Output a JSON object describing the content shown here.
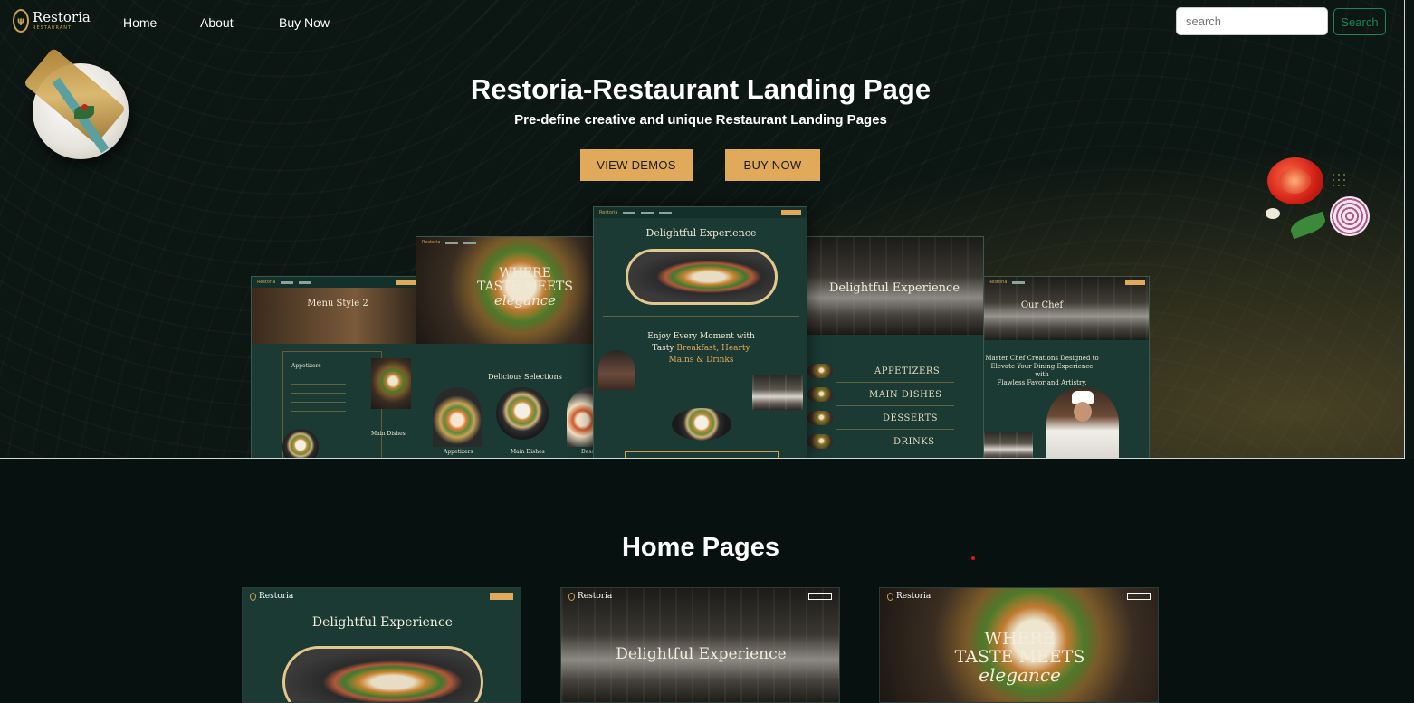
{
  "brand": {
    "name": "Restoria",
    "sub": "RESTAURANT"
  },
  "nav": {
    "items": [
      "Home",
      "About",
      "Buy Now"
    ]
  },
  "search": {
    "placeholder": "search",
    "button": "Search"
  },
  "hero": {
    "title": "Restoria-Restaurant Landing Page",
    "subtitle": "Pre-define creative and unique Restaurant Landing Pages",
    "btn_demos": "VIEW DEMOS",
    "btn_buy": "BUY NOW"
  },
  "mockups": {
    "m1_title": "Menu Style 2",
    "m1_section": "Appetizers",
    "m1_section2": "Main Dishes",
    "m2_title_1": "WHERE",
    "m2_title_2": "TASTE MEETS",
    "m2_title_3": "elegance",
    "m2_section": "Delicious Selections",
    "m2_cap1": "Appetizers",
    "m2_cap2": "Main Dishes",
    "m2_cap3": "Dess",
    "m3_title": "Delightful Experience",
    "m3_mid_1": "Enjoy Every Moment with",
    "m3_mid_2": "Tasty",
    "m3_mid_2b": "Breakfast, Hearty",
    "m3_mid_3": "Mains &",
    "m3_mid_3b": "Drinks",
    "m4_title": "Delightful Experience",
    "m4_items": [
      "APPETIZERS",
      "MAIN DISHES",
      "DESSERTS",
      "DRINKS"
    ],
    "m5_title": "Our Chef",
    "m5_text_1": "Master Chef Creations Designed to",
    "m5_text_2": "Elevate Your Dining Experience with",
    "m5_text_3": "Flawless Favor and Artistry."
  },
  "home_pages": {
    "title": "Home Pages",
    "cards": [
      {
        "title": "Delightful Experience"
      },
      {
        "title": "Delightful Experience"
      },
      {
        "title_1": "WHERE",
        "title_2": "TASTE MEETS",
        "title_3": "elegance"
      }
    ]
  },
  "colors": {
    "accent": "#e1a95a",
    "search_btn": "#198754",
    "bg": "#071210"
  }
}
